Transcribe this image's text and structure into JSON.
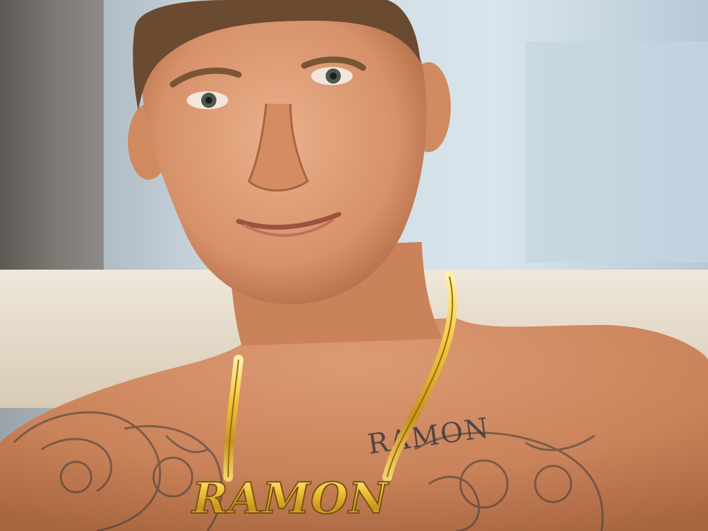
{
  "scene": {
    "description_colors": {
      "window_sky": "#cfdde6",
      "window_far": "#a9bccb",
      "curtain": "#6f6a66",
      "sofa": "#e6dccd",
      "skin_light": "#e3a47e",
      "skin_mid": "#c98259",
      "skin_shadow": "#9c5b3c",
      "hair": "#6a4a30",
      "gold": "#e2b230",
      "gold_dark": "#9a6a10",
      "tattoo_ink": "#3b3b40"
    }
  },
  "necklace": {
    "pendant_text": "RAMON"
  },
  "tattoo": {
    "chest_text": "RAMON"
  }
}
